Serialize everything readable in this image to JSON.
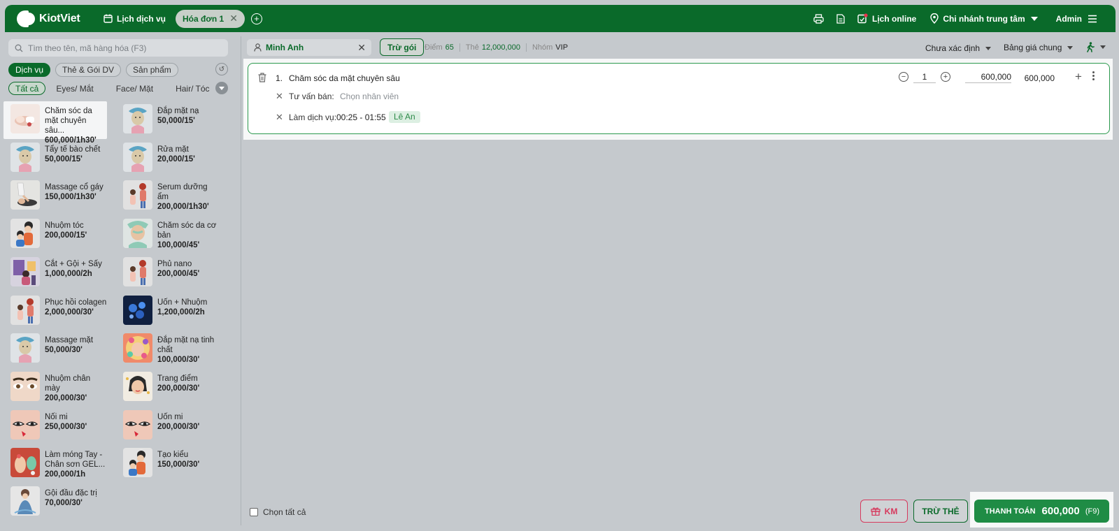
{
  "brand": {
    "name": "KiotViet"
  },
  "topbar": {
    "schedule_label": "Lịch dịch vụ",
    "active_tab": "Hóa đơn 1",
    "online_label": "Lịch online",
    "branch_label": "Chi nhánh trung tâm",
    "user_label": "Admin"
  },
  "search": {
    "placeholder": "Tìm theo tên, mã hàng hóa (F3)"
  },
  "categories": [
    "Dịch vụ",
    "Thẻ & Gói DV",
    "Sản phẩm"
  ],
  "subcategories": [
    "Tất cả",
    "Eyes/ Mắt",
    "Face/ Mặt",
    "Hair/ Tóc"
  ],
  "items": [
    {
      "name": "Chăm sóc da mặt chuyên sâu...",
      "price": "600,000/1h30'",
      "thumb": "facial"
    },
    {
      "name": "Đắp mặt nạ",
      "price": "50,000/15'",
      "thumb": "mask"
    },
    {
      "name": "Tẩy tế bào chết",
      "price": "50,000/15'",
      "thumb": "mask"
    },
    {
      "name": "Rửa mặt",
      "price": "20,000/15'",
      "thumb": "mask"
    },
    {
      "name": "Massage cổ gáy",
      "price": "150,000/1h30'",
      "thumb": "massage"
    },
    {
      "name": "Serum dưỡng ẩm",
      "price": "200,000/1h30'",
      "thumb": "duo"
    },
    {
      "name": "Nhuộm tóc",
      "price": "200,000/15'",
      "thumb": "hair"
    },
    {
      "name": "Chăm sóc da cơ bản",
      "price": "100,000/45'",
      "thumb": "spa"
    },
    {
      "name": "Cắt + Gội + Sấy",
      "price": "1,000,000/2h",
      "thumb": "salon"
    },
    {
      "name": "Phủ nano",
      "price": "200,000/45'",
      "thumb": "duo"
    },
    {
      "name": "Phục hồi colagen",
      "price": "2,000,000/30'",
      "thumb": "duo"
    },
    {
      "name": "Uốn + Nhuộm",
      "price": "1,200,000/2h",
      "thumb": "blue"
    },
    {
      "name": "Massage mặt",
      "price": "50,000/30'",
      "thumb": "mask"
    },
    {
      "name": "Đắp mặt nạ tinh chất",
      "price": "100,000/30'",
      "thumb": "flower"
    },
    {
      "name": "Nhuộm chân mày",
      "price": "200,000/30'",
      "thumb": "eyes"
    },
    {
      "name": "Trang điểm",
      "price": "200,000/30'",
      "thumb": "makeup"
    },
    {
      "name": "Nối mi",
      "price": "250,000/30'",
      "thumb": "lashes"
    },
    {
      "name": "Uốn mi",
      "price": "200,000/30'",
      "thumb": "lashes"
    },
    {
      "name": "Làm móng Tay - Chân sơn GEL...",
      "price": "200,000/1h",
      "thumb": "nails"
    },
    {
      "name": "Tạo kiểu",
      "price": "150,000/30'",
      "thumb": "hair"
    },
    {
      "name": "Gội đầu đặc trị",
      "price": "70,000/30'",
      "thumb": "wash"
    }
  ],
  "customer": {
    "name": "Minh Anh",
    "deduct_package": "Trừ gói",
    "points_label": "Điểm",
    "points_value": "65",
    "card_label": "Thẻ",
    "card_value": "12,000,000",
    "group_label": "Nhóm",
    "group_value": "VIP"
  },
  "filters": {
    "status": "Chưa xác định",
    "price_list": "Bảng giá chung"
  },
  "order_line": {
    "index": "1.",
    "name": "Chăm sóc da mặt chuyên sâu",
    "quantity": "1",
    "unit_price": "600,000",
    "total": "600,000",
    "consultant_label": "Tư vấn bán:",
    "consultant_placeholder": "Chọn nhân viên",
    "service_label": "Làm dịch vụ:",
    "service_time": "00:25 - 01:55",
    "service_staff": "Lê An"
  },
  "bottom": {
    "select_all": "Chọn tất cả",
    "promo": "KM",
    "deduct_card": "TRỪ THẺ",
    "pay_label": "THANH TOÁN",
    "pay_amount": "600,000",
    "pay_key": "(F9)"
  },
  "colors": {
    "primary": "#0a6a2a",
    "pay": "#1f8c45",
    "promo": "#d63a5e"
  }
}
